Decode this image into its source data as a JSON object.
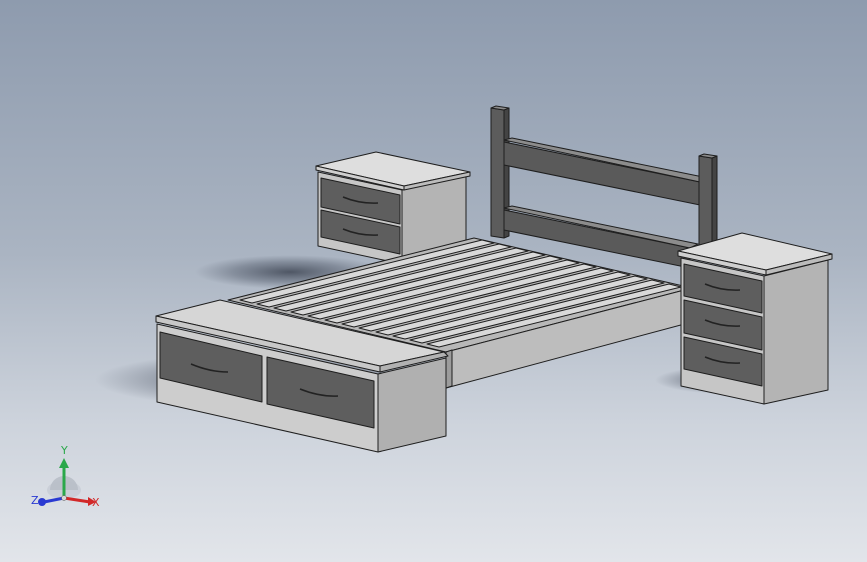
{
  "viewport": {
    "colors": {
      "edge": "#1e1e1e",
      "face_light": "#dadada",
      "face_mid": "#c2c2c2",
      "face_dark": "#a9a9a9",
      "drawer_front": "#5f5f5f",
      "drawer_front_dark": "#525252",
      "shadow": "#2f3644"
    }
  },
  "triad": {
    "x_label": "X",
    "y_label": "Y",
    "z_label": "Z",
    "x_color": "#d22828",
    "y_color": "#2aa84a",
    "z_color": "#2a3ad2"
  }
}
